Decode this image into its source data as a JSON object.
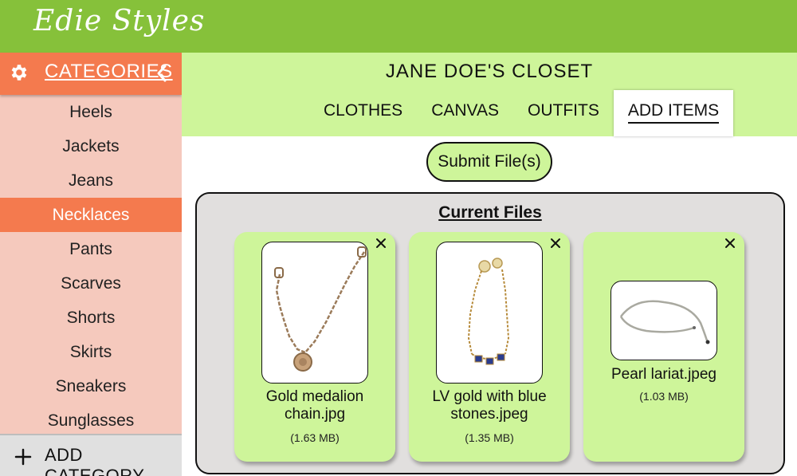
{
  "app": {
    "logo_text": "Edie Styles"
  },
  "colors": {
    "topbar": "#86c13a",
    "accent_orange": "#f47a4e",
    "sidebar_bg": "#f5c9bd",
    "header_bg": "#cef59a",
    "panel_bg": "#e1dfde"
  },
  "sidebar": {
    "header_label": "CATEGORIES",
    "header_icon": "gear-icon",
    "collapse_icon": "chevron-left-icon",
    "items": [
      {
        "label": "Heels",
        "active": false
      },
      {
        "label": "Jackets",
        "active": false
      },
      {
        "label": "Jeans",
        "active": false
      },
      {
        "label": "Necklaces",
        "active": true
      },
      {
        "label": "Pants",
        "active": false
      },
      {
        "label": "Scarves",
        "active": false
      },
      {
        "label": "Shorts",
        "active": false
      },
      {
        "label": "Skirts",
        "active": false
      },
      {
        "label": "Sneakers",
        "active": false
      },
      {
        "label": "Sunglasses",
        "active": false
      }
    ],
    "add_category_label": "ADD CATEGORY"
  },
  "header": {
    "closet_title": "JANE DOE'S CLOSET",
    "tabs": [
      {
        "label": "CLOTHES",
        "active": false
      },
      {
        "label": "CANVAS",
        "active": false
      },
      {
        "label": "OUTFITS",
        "active": false
      },
      {
        "label": "ADD ITEMS",
        "active": true
      }
    ]
  },
  "upload": {
    "submit_label": "Submit File(s)"
  },
  "files": {
    "title": "Current Files",
    "items": [
      {
        "name": "Gold medalion chain.jpg",
        "size": "(1.63 MB)"
      },
      {
        "name": "LV gold with blue stones.jpeg",
        "size": "(1.35 MB)"
      },
      {
        "name": "Pearl lariat.jpeg",
        "size": "(1.03 MB)"
      }
    ]
  }
}
